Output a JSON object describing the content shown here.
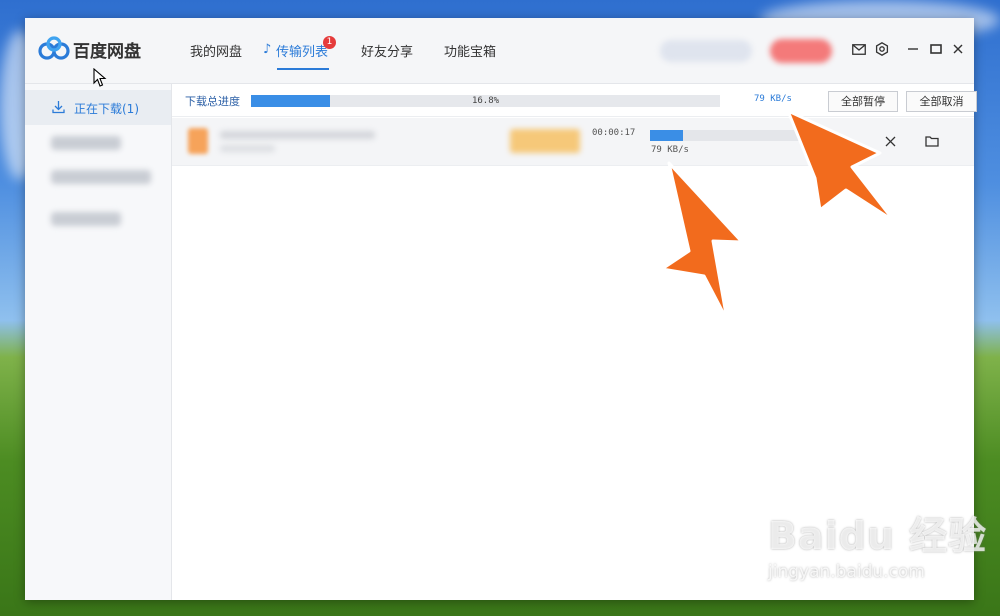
{
  "app": {
    "name": "百度网盘",
    "nav_tabs": [
      {
        "label": "我的网盘"
      },
      {
        "label": "传输列表",
        "badge": "1",
        "active": true
      },
      {
        "label": "好友分享"
      },
      {
        "label": "功能宝箱"
      }
    ],
    "title_icons": [
      "mail-icon",
      "settings-icon",
      "minimize-icon",
      "maximize-icon",
      "close-icon"
    ]
  },
  "sidebar": {
    "active_item": {
      "label": "正在下载(1)",
      "icon": "download-icon"
    }
  },
  "summary": {
    "label": "下载总进度",
    "progress": 0.168,
    "percent_text": "16.8%",
    "speed": "79 KB/s",
    "pause_all": "全部暂停",
    "cancel_all": "全部取消"
  },
  "task": {
    "remaining_time": "00:00:17",
    "progress": 0.22,
    "speed": "79 KB/s",
    "actions": [
      "close-icon",
      "folder-icon"
    ]
  },
  "watermark": {
    "brand": "Baidu 经验",
    "url": "jingyan.baidu.com"
  },
  "colors": {
    "accent": "#2b7bd8",
    "progress": "#3a8ee6",
    "badge": "#e53b3b",
    "arrow": "#f26b1d"
  }
}
